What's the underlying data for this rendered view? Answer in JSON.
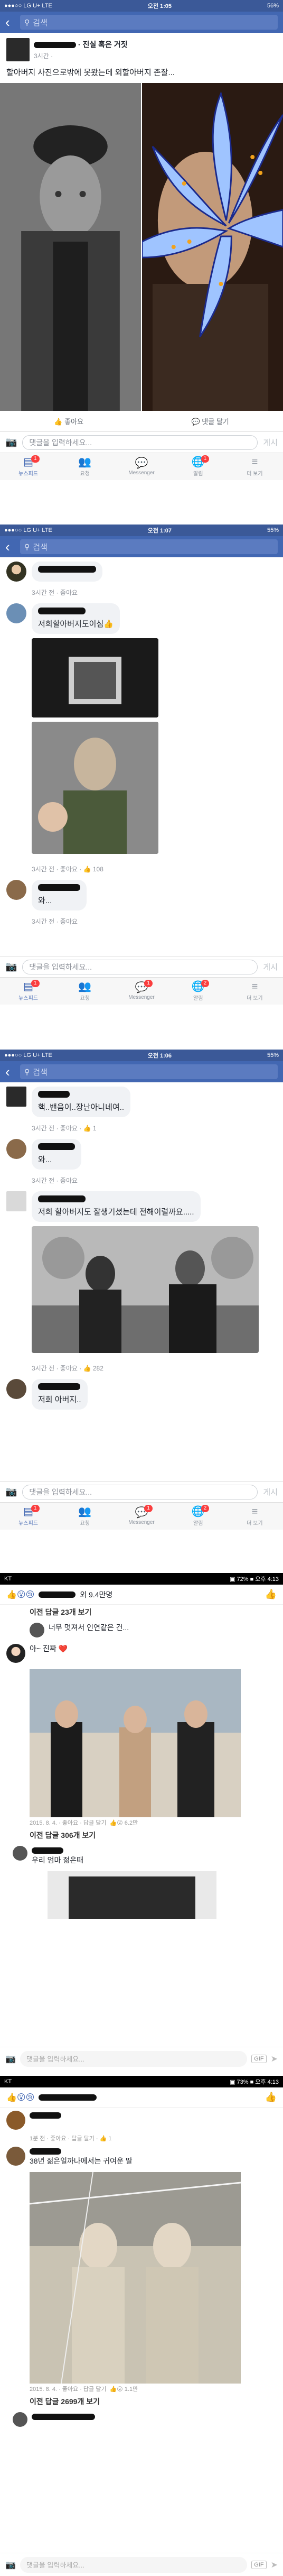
{
  "s1": {
    "status": {
      "carrier": "●●●○○ LG U+  LTE",
      "time": "오전 1:05",
      "battery": "56%"
    },
    "search_placeholder": "검색",
    "post": {
      "title": "· 진실 혹은 거짓",
      "meta": "3시간 ·",
      "text": "할아버지 사진으로밖에 못봤는데 외할아버지 존잘...",
      "like_label": "좋아요",
      "comment_label": "댓글 달기"
    },
    "input_placeholder": "댓글을 입력하세요...",
    "post_label": "게시",
    "tabs": [
      {
        "label": "뉴스피드",
        "badge": "1"
      },
      {
        "label": "요청",
        "badge": ""
      },
      {
        "label": "Messenger",
        "badge": ""
      },
      {
        "label": "알림",
        "badge": "1"
      },
      {
        "label": "더 보기",
        "badge": ""
      }
    ]
  },
  "s2": {
    "status": {
      "carrier": "●●●○○ LG U+  LTE",
      "time": "오전 1:07",
      "battery": "55%"
    },
    "search_placeholder": "검색",
    "c1_meta": "3시간 전 · 좋아요",
    "c2_text": "저희할아버지도이심👍",
    "c2_meta": "3시간 전 · 좋아요 · 👍 108",
    "c3_text": "와...",
    "c3_meta": "3시간 전 · 좋아요",
    "input_placeholder": "댓글을 입력하세요...",
    "post_label": "게시",
    "tabs": [
      {
        "label": "뉴스피드",
        "badge": "1"
      },
      {
        "label": "요청",
        "badge": ""
      },
      {
        "label": "Messenger",
        "badge": "1"
      },
      {
        "label": "알림",
        "badge": "2"
      },
      {
        "label": "더 보기",
        "badge": ""
      }
    ]
  },
  "s3": {
    "status": {
      "carrier": "●●●○○ LG U+  LTE",
      "time": "오전 1:06",
      "battery": "55%"
    },
    "search_placeholder": "검색",
    "c1_text": "핵..밴음이..장난아니네여..",
    "c1_meta": "3시간 전 · 좋아요 · 👍 1",
    "c2_text": "와...",
    "c2_meta": "3시간 전 · 좋아요",
    "c3_text": "저희 할아버지도 잘생기셨는데 전해이럴까요.....",
    "c3_meta": "3시간 전 · 좋아요 · 👍 282",
    "c4_text": "저희 아버지..",
    "input_placeholder": "댓글을 입력하세요...",
    "post_label": "게시",
    "tabs": [
      {
        "label": "뉴스피드",
        "badge": "1"
      },
      {
        "label": "요청",
        "badge": ""
      },
      {
        "label": "Messenger",
        "badge": "1"
      },
      {
        "label": "알림",
        "badge": "2"
      },
      {
        "label": "더 보기",
        "badge": ""
      }
    ]
  },
  "s4": {
    "status": {
      "carrier": "KT",
      "right": "▣ 72% ■ 오후 4:13"
    },
    "header_text": "외 9.4만명",
    "reply_link1": "이전 답글 23개 보기",
    "r1_text": "너무 멋져서 인연같은 건...",
    "r2_text": "아~ 진짜 ❤️",
    "photo_date": "2015. 8. 4. · 좋아요 · 답글 달기",
    "photo_likes": "6.2만",
    "reply_link2": "이전 답글 306개 보기",
    "r3_text": "우리 엄마 젊은때",
    "input_placeholder": "댓글을 입력하세요...",
    "gif_label": "GIF"
  },
  "s5": {
    "status": {
      "carrier": "KT",
      "right": "▣ 73% ■ 오후 4:13"
    },
    "r1_meta": "1분 전 · 좋아요 · 답글 달기 · 👍 1",
    "r2_text": "38년 젊은일까나에서는 귀여운 딸",
    "photo_meta": "2015. 8. 4. · 좋아요 · 답글 달기",
    "photo_likes": "1.1만",
    "reply_link": "이전 답글 2699개 보기",
    "input_placeholder": "댓글을 입력하세요...",
    "gif_label": "GIF"
  }
}
